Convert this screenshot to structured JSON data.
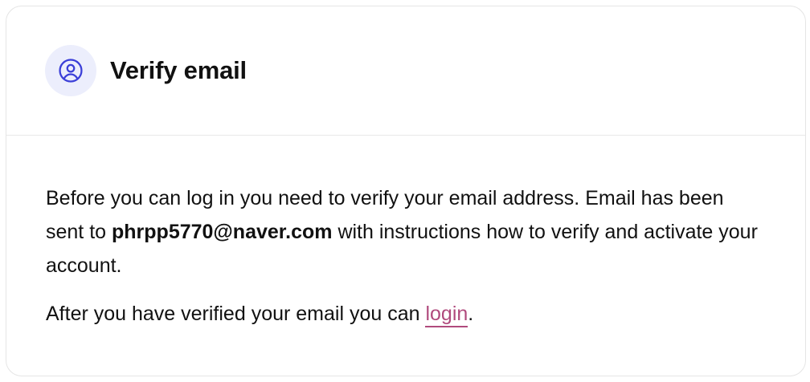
{
  "header": {
    "title": "Verify email",
    "icon": "user-circle-icon",
    "icon_color": "#3b3fd8",
    "icon_bg": "#eceefc"
  },
  "body": {
    "paragraph1_before": "Before you can log in you need to verify your email address. Email has been sent to ",
    "email": "phrpp5770@naver.com",
    "paragraph1_after": " with instructions how to verify and activate your account.",
    "paragraph2_before": "After you have verified your email you can ",
    "login_link": "login",
    "paragraph2_after": ".",
    "link_color": "#b04a7d"
  }
}
